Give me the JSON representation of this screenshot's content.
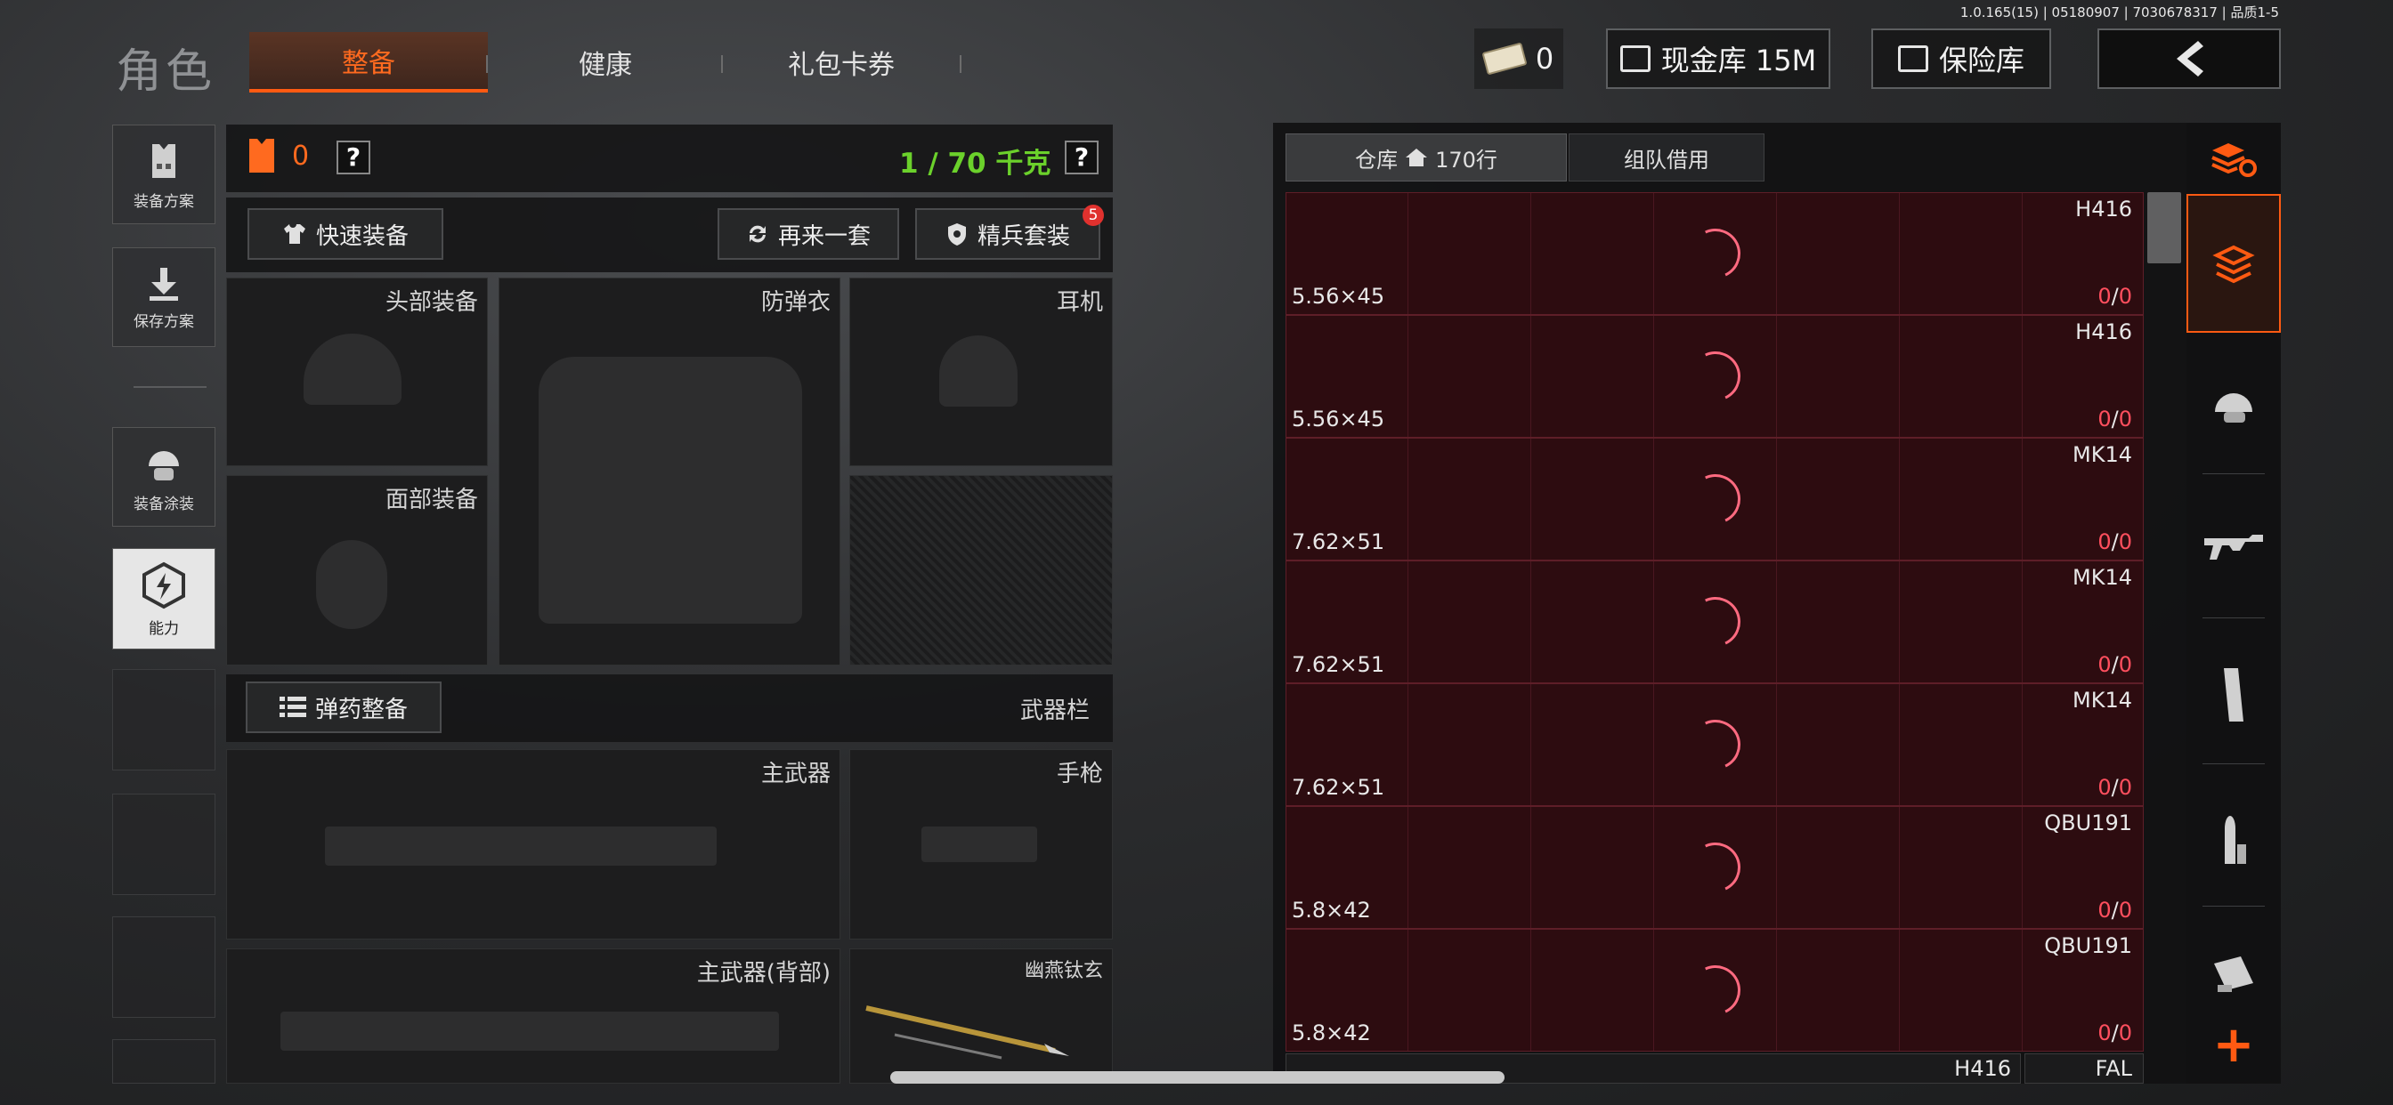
{
  "version": "1.0.165(15) | 05180907 | 7030678317 | 品质1-5",
  "header": {
    "title": "角色",
    "tabs": [
      {
        "label": "整备",
        "active": true
      },
      {
        "label": "健康",
        "active": false
      },
      {
        "label": "礼包卡券",
        "active": false
      }
    ],
    "cash_value": "0",
    "cash_vault": "现金库 15M",
    "safe_box": "保险库"
  },
  "sidebar": {
    "items": [
      {
        "label": "装备方案",
        "icon": "vest-icon"
      },
      {
        "label": "保存方案",
        "icon": "download-icon"
      },
      {
        "label": "装备涂装",
        "icon": "helmet-paint-icon"
      },
      {
        "label": "能力",
        "icon": "ability-icon",
        "selected": true
      }
    ]
  },
  "loadout": {
    "armor_count": "0",
    "help": "?",
    "weight": "1 / 70 千克",
    "quick_equip": "快速装备",
    "reroll": "再来一套",
    "elite_set": "精兵套装",
    "elite_badge": "5",
    "slots": {
      "head": "头部装备",
      "vest": "防弹衣",
      "headset": "耳机",
      "face": "面部装备"
    },
    "ammo_button": "弹药整备",
    "weapons_label": "武器栏",
    "weapon_slots": {
      "primary": "主武器",
      "pistol": "手枪",
      "primary_back": "主武器(背部)",
      "melee": "幽燕钛玄"
    }
  },
  "warehouse": {
    "tab_storage": "仓库",
    "storage_rows": "170行",
    "tab_team": "组队借用",
    "rows": [
      {
        "name": "H416",
        "caliber": "5.56×45",
        "have": "0",
        "need": "0"
      },
      {
        "name": "H416",
        "caliber": "5.56×45",
        "have": "0",
        "need": "0"
      },
      {
        "name": "MK14",
        "caliber": "7.62×51",
        "have": "0",
        "need": "0"
      },
      {
        "name": "MK14",
        "caliber": "7.62×51",
        "have": "0",
        "need": "0"
      },
      {
        "name": "MK14",
        "caliber": "7.62×51",
        "have": "0",
        "need": "0"
      },
      {
        "name": "QBU191",
        "caliber": "5.8×42",
        "have": "0",
        "need": "0"
      },
      {
        "name": "QBU191",
        "caliber": "5.8×42",
        "have": "0",
        "need": "0"
      }
    ],
    "partial_row": {
      "left_name": "H416",
      "right_name": "FAL"
    }
  },
  "filters": {
    "items": [
      "refresh-stack-icon",
      "stack-icon",
      "helmet-icon",
      "rifle-icon",
      "magazine-icon",
      "bullet-icon",
      "sight-icon"
    ],
    "add": "+"
  },
  "colors": {
    "accent": "#ff5a12",
    "weight_green": "#6bd12b",
    "row_bg": "#2d0c10",
    "count_red": "#ff4f5e"
  }
}
